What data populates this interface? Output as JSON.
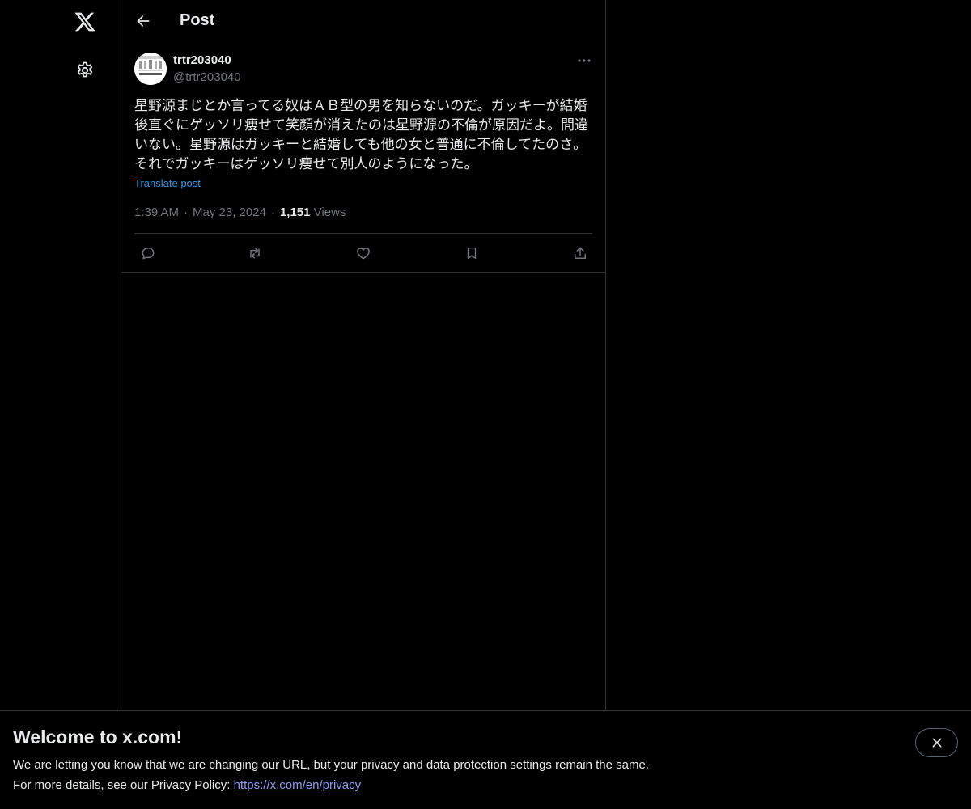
{
  "nav": {
    "logo_icon": "x-logo-icon",
    "settings_icon": "gear-icon"
  },
  "header": {
    "back_icon": "arrow-left-icon",
    "title": "Post"
  },
  "post": {
    "author": {
      "display_name": "trtr203040",
      "handle": "@trtr203040",
      "avatar": "avatar-image"
    },
    "more_icon": "ellipsis-icon",
    "text": "星野源まじとか言ってる奴はＡＢ型の男を知らないのだ。ガッキーが結婚後直ぐにゲッソリ痩せて笑顔が消えたのは星野源の不倫が原因だよ。間違いない。星野源はガッキーと結婚しても他の女と普通に不倫してたのさ。それでガッキーはゲッソリ痩せて別人のようになった。",
    "translate_label": "Translate post",
    "time": "1:39 AM",
    "date": "May 23, 2024",
    "separator": "·",
    "views_count": "1,151",
    "views_label": "Views",
    "actions": {
      "reply_icon": "reply-icon",
      "repost_icon": "repost-icon",
      "like_icon": "heart-icon",
      "bookmark_icon": "bookmark-icon",
      "share_icon": "share-icon"
    }
  },
  "banner": {
    "title": "Welcome to x.com!",
    "line1": "We are letting you know that we are changing our URL, but your privacy and data protection settings remain the same.",
    "line2_prefix": "For more details, see our Privacy Policy: ",
    "link_text": "https://x.com/en/privacy",
    "close_icon": "close-icon"
  },
  "colors": {
    "background": "#000000",
    "text": "#e7e9ea",
    "muted": "#71767b",
    "accent": "#1d9bf0",
    "border": "#2f3336",
    "link": "#8c9cf2"
  }
}
